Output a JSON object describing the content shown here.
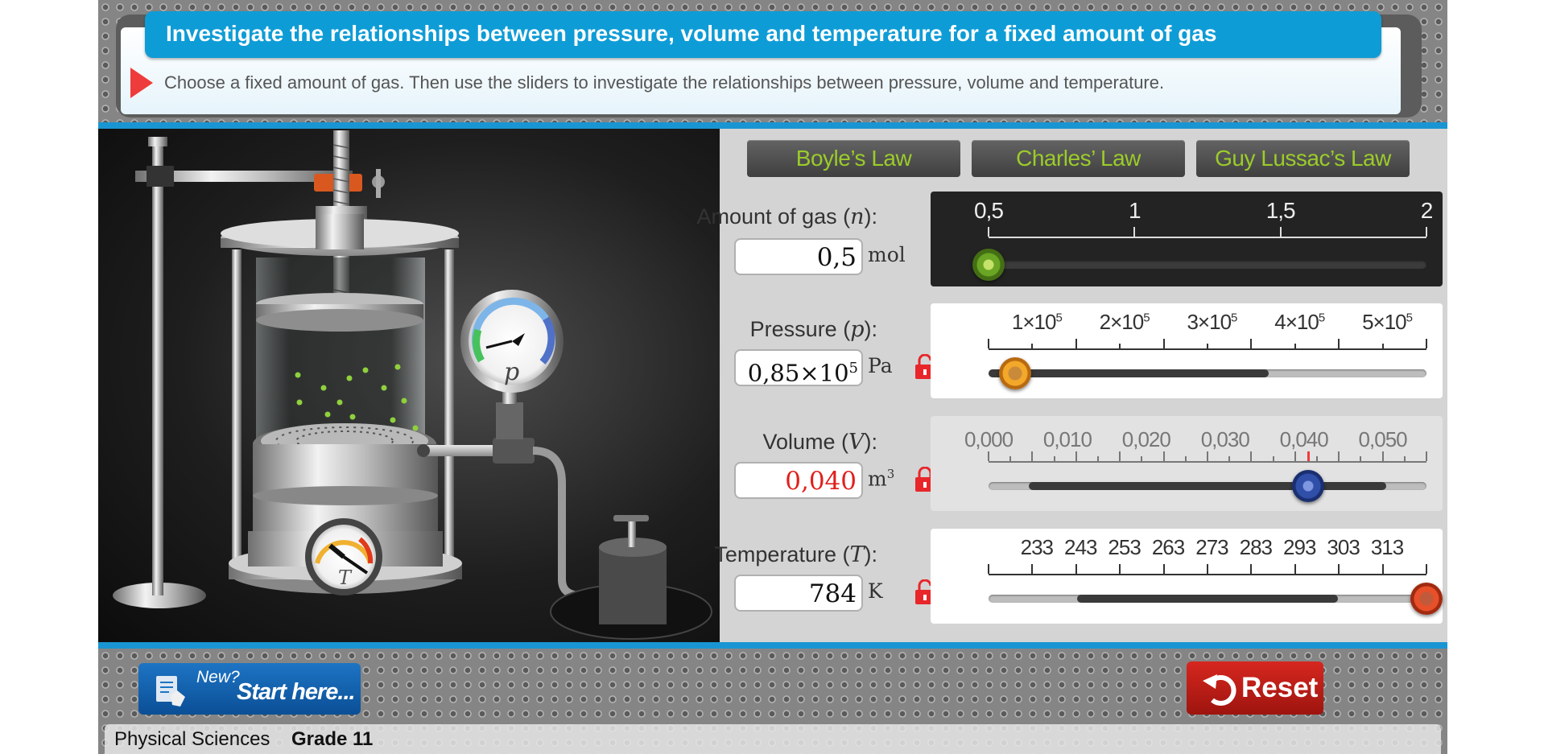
{
  "header": {
    "title": "Investigate the relationships between pressure, volume and temperature for a fixed amount of gas",
    "instruction": "Choose a fixed amount of gas. Then use the sliders to investigate the relationships between pressure, volume and temperature."
  },
  "laws": [
    "Boyle’s Law",
    "Charles’ Law",
    "Guy Lussac’s Law"
  ],
  "colors": {
    "accent": "#0e9cd6",
    "law_text": "#9bcb2a",
    "reset": "#c8201a",
    "start": "#1565b8",
    "volume_value": "#e0201c"
  },
  "scene": {
    "pressure_gauge_symbol": "p",
    "temperature_gauge_symbol": "T"
  },
  "controls": {
    "amount": {
      "label": "Amount of gas (",
      "var": "n",
      "value": "0,5",
      "unit": "mol",
      "ticks": [
        "0,5",
        "1",
        "1,5",
        "2"
      ],
      "level": 0.0,
      "knob_color": "green"
    },
    "pressure": {
      "label": "Pressure (",
      "var": "p",
      "value_mantissa": "0,85",
      "value_exp": "5",
      "value_text": "0,85×10",
      "unit": "Pa",
      "ticks": [
        "1×10",
        "2×10",
        "3×10",
        "4×10",
        "5×10"
      ],
      "tick_exp": "5",
      "locked": false,
      "level": 0.06,
      "knob_color": "orange"
    },
    "volume": {
      "label": "Volume (",
      "var": "V",
      "value": "0,040",
      "unit": "m",
      "unit_exp": "3",
      "ticks": [
        "0,000",
        "0,010",
        "0,020",
        "0,030",
        "0,040",
        "0,050"
      ],
      "locked": true,
      "level": 0.73,
      "knob_color": "blue"
    },
    "temperature": {
      "label": "Temperature (",
      "var": "T",
      "value": "784",
      "unit": "K",
      "ticks": [
        "233",
        "243",
        "253",
        "263",
        "273",
        "283",
        "293",
        "303",
        "313"
      ],
      "locked": false,
      "level": 1.0,
      "knob_color": "red"
    }
  },
  "footer": {
    "start_new": "New?",
    "start_label": "Start here...",
    "reset_label": "Reset",
    "subject": "Physical Sciences",
    "grade": "Grade 11"
  }
}
